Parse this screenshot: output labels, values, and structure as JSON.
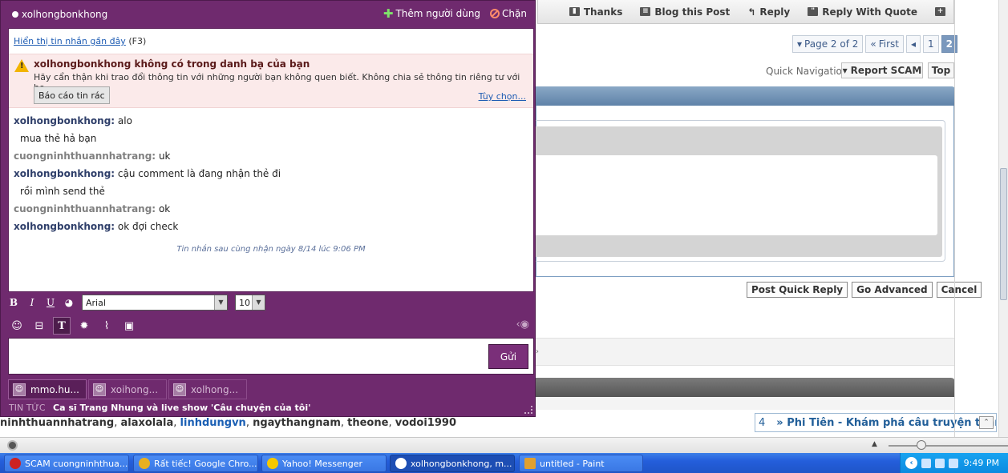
{
  "forum": {
    "post_actions": [
      {
        "label": "Thanks",
        "icon": "thanks-icon"
      },
      {
        "label": "Blog this Post",
        "icon": "blog-icon"
      },
      {
        "label": "Reply",
        "icon": "reply-icon"
      },
      {
        "label": "Reply With Quote",
        "icon": "quote-icon"
      }
    ],
    "pagination": {
      "page_info": "Page 2 of 2",
      "first": "First",
      "pages": [
        "1",
        "2"
      ],
      "current": "2"
    },
    "quick_navigation": "Quick Navigation",
    "report_scam": "Report SCAM",
    "top": "Top",
    "quick_reply_buttons": {
      "post": "Post Quick Reply",
      "advanced": "Go Advanced",
      "cancel": "Cancel"
    },
    "users_online": [
      {
        "name": "ninhthuannhatrang",
        "highlight": false
      },
      {
        "name": "alaxolala",
        "highlight": false
      },
      {
        "name": "linhdungvn",
        "highlight": true
      },
      {
        "name": "ngaythangnam",
        "highlight": false
      },
      {
        "name": "theone",
        "highlight": false
      },
      {
        "name": "vodoi1990",
        "highlight": false
      }
    ],
    "ticker": {
      "number": "4",
      "title": "» Phi Tiên - Khám phá câu truyện thần"
    }
  },
  "chat": {
    "contact": "xolhongbonkhong",
    "add_user": "Thêm người dùng",
    "block": "Chặn",
    "recent_link": "Hiển thị tin nhắn gần đây",
    "recent_shortcut": "(F3)",
    "warning": {
      "title": "xolhongbonkhong không có trong danh bạ của bạn",
      "text": "Hãy cẩn thận khi trao đổi thông tin với những người bạn không quen biết. Không chia sẻ thông tin riêng tư với họ.",
      "spam_button": "Báo cáo tin rác",
      "options_link": "Tùy chọn..."
    },
    "messages": [
      {
        "sender": "xolhongbonkhong:",
        "text": "alo",
        "self": false
      },
      {
        "sender": "",
        "text": "mua thẻ hả bạn",
        "self": false
      },
      {
        "sender": "cuongninhthuannhatrang:",
        "text": "uk",
        "self": true
      },
      {
        "sender": "xolhongbonkhong:",
        "text": "cậu comment là đang nhận thẻ đi",
        "self": false
      },
      {
        "sender": "",
        "text": "rồi mình send thẻ",
        "self": false
      },
      {
        "sender": "cuongninhthuannhatrang:",
        "text": "ok",
        "self": true
      },
      {
        "sender": "xolhongbonkhong:",
        "text": "ok đợi check",
        "self": false
      }
    ],
    "last_received": "Tin nhắn sau cùng nhận ngày 8/14 lúc 9:06 PM",
    "font": "Arial",
    "font_size": "10",
    "send": "Gửi",
    "tabs": [
      {
        "label": "mmo.hu...",
        "active": true
      },
      {
        "label": "xoihong...",
        "active": false
      },
      {
        "label": "xolhong...",
        "active": false
      }
    ],
    "news_label": "TIN TỨC",
    "news_headline": "Ca sĩ Trang Nhung và live show 'Câu chuyện của tôi'"
  },
  "taskbar": {
    "tasks": [
      {
        "label": "SCAM cuongninhthua...",
        "icon_color": "#cc2222",
        "active": false
      },
      {
        "label": "Rất tiếc! Google Chro...",
        "icon_color": "#e8b020",
        "active": false
      },
      {
        "label": "Yahoo! Messenger",
        "icon_color": "#f5c800",
        "active": false
      },
      {
        "label": "xolhongbonkhong, m...",
        "icon_color": "#ffffff",
        "active": true
      },
      {
        "label": "untitled - Paint",
        "icon_color": "#e0a030",
        "active": false
      }
    ],
    "clock": "9:49 PM"
  }
}
